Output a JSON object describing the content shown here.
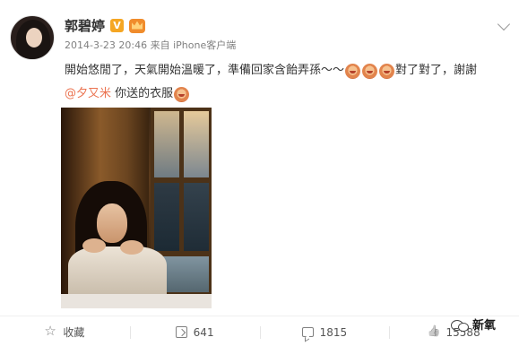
{
  "post": {
    "username": "郭碧婷",
    "verified_badge": "V",
    "meta": "2014-3-23 20:46 来自 iPhone客户端",
    "text": {
      "line1_part1": "開始悠閒了，天氣開始溫暖了，準備回家含飴弄孫～～",
      "line1_part2": "對了對了，謝謝",
      "mention": "@夕又米",
      "line2_part2": " 你送的衣服"
    }
  },
  "actions": {
    "favorite_label": "收藏",
    "repost_count": "641",
    "comment_count": "1815",
    "like_count": "15588"
  },
  "watermark": {
    "text": "新氧"
  },
  "icons": {
    "favorite": "star-icon",
    "repost": "repost-icon",
    "comment": "comment-icon",
    "like": "thumbs-up-icon",
    "menu": "chevron-down-icon"
  },
  "colors": {
    "mention": "#eb7350",
    "verified": "#f5a623",
    "meta_text": "#808080"
  }
}
